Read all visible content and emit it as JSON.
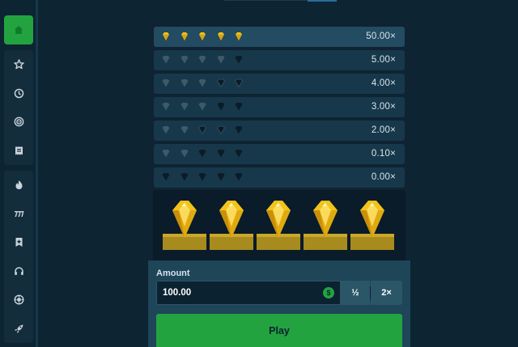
{
  "sidebar": {
    "home_icon": "house-icon",
    "group1": [
      {
        "name": "star-icon"
      },
      {
        "name": "history-icon"
      },
      {
        "name": "target-icon"
      },
      {
        "name": "receipt-icon"
      }
    ],
    "group2": [
      {
        "name": "flame-icon"
      },
      {
        "name": "sevens-icon"
      },
      {
        "name": "bookmark-star-icon"
      },
      {
        "name": "headset-icon"
      },
      {
        "name": "gear-badge-icon"
      },
      {
        "name": "rocket-icon"
      }
    ]
  },
  "paytable": [
    {
      "multiplier": "50.00×",
      "gems": [
        "gold",
        "gold",
        "gold",
        "gold",
        "gold"
      ],
      "active": true
    },
    {
      "multiplier": "5.00×",
      "gems": [
        "gray",
        "gray",
        "gray",
        "gray",
        "dark"
      ],
      "active": false
    },
    {
      "multiplier": "4.00×",
      "gems": [
        "gray",
        "gray",
        "gray",
        "dark-outline",
        "dark-outline"
      ],
      "active": false
    },
    {
      "multiplier": "3.00×",
      "gems": [
        "gray",
        "gray",
        "gray",
        "dark",
        "dark"
      ],
      "active": false
    },
    {
      "multiplier": "2.00×",
      "gems": [
        "gray",
        "gray",
        "dark-outline",
        "dark-outline",
        "dark"
      ],
      "active": false
    },
    {
      "multiplier": "0.10×",
      "gems": [
        "gray",
        "gray",
        "dark",
        "dark",
        "dark"
      ],
      "active": false
    },
    {
      "multiplier": "0.00×",
      "gems": [
        "dark",
        "dark",
        "dark",
        "dark",
        "dark"
      ],
      "active": false
    }
  ],
  "reels": [
    "gold-gem",
    "gold-gem",
    "gold-gem",
    "gold-gem",
    "gold-gem"
  ],
  "controls": {
    "amount_label": "Amount",
    "amount_value": "100.00",
    "currency_symbol": "$",
    "half_label": "½",
    "double_label": "2×",
    "play_label": "Play"
  },
  "colors": {
    "accent_green": "#23a340",
    "gold": "#f2c41a",
    "gem_gray": "#3f5a66"
  }
}
